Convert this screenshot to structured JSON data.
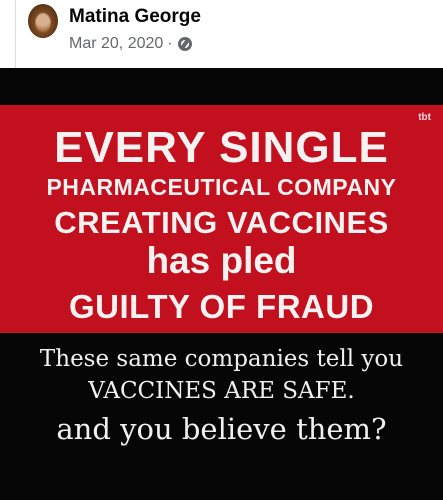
{
  "post": {
    "author": "Matina George",
    "date": "Mar 20, 2020",
    "separator": "·",
    "audience_icon": "globe-icon"
  },
  "image": {
    "headline_lines": [
      "EVERY SINGLE",
      "PHARMACEUTICAL COMPANY",
      "CREATING VACCINES",
      "has pled",
      "GUILTY OF FRAUD"
    ],
    "watermark": "tbt",
    "caption_lines": [
      "These same companies tell you",
      "VACCINES ARE SAFE.",
      "and you believe them?"
    ]
  },
  "colors": {
    "red_panel": "#c3101e",
    "image_background": "#060606",
    "meta_text": "#65676b"
  }
}
